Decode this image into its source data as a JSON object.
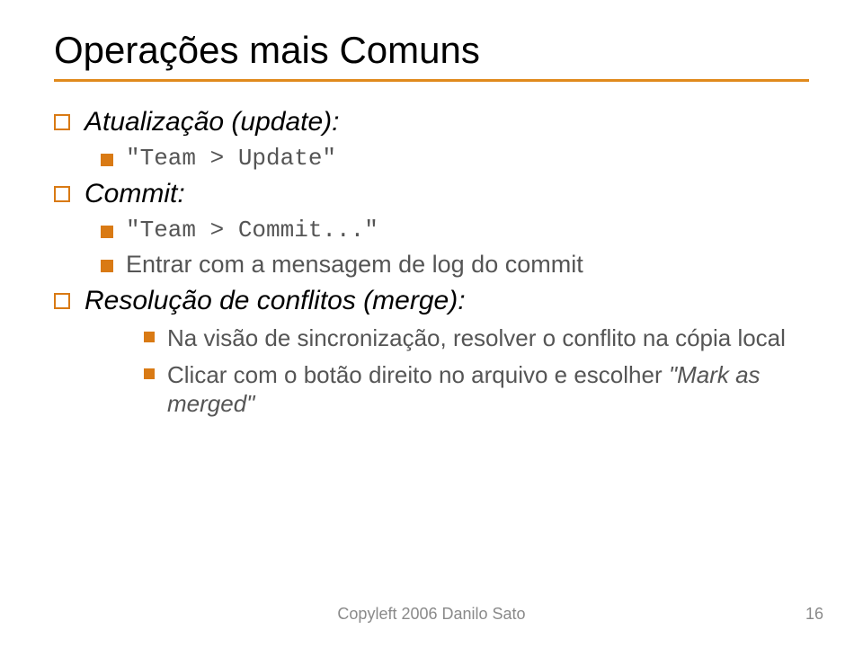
{
  "title": "Operações mais Comuns",
  "bullets": {
    "update_heading": "Atualização (update):",
    "update_cmd": "\"Team > Update\"",
    "commit_heading": "Commit:",
    "commit_cmd": "\"Team > Commit...\"",
    "commit_note": "Entrar com a mensagem de log do commit",
    "resolve_heading": "Resolução de conflitos (merge):",
    "resolve_step1": "Na visão de sincronização, resolver o conflito na cópia local",
    "resolve_step2_prefix": "Clicar com o botão direito no arquivo e escolher ",
    "resolve_step2_italic": "\"Mark as merged\""
  },
  "footer": "Copyleft 2006 Danilo Sato",
  "page_number": "16"
}
